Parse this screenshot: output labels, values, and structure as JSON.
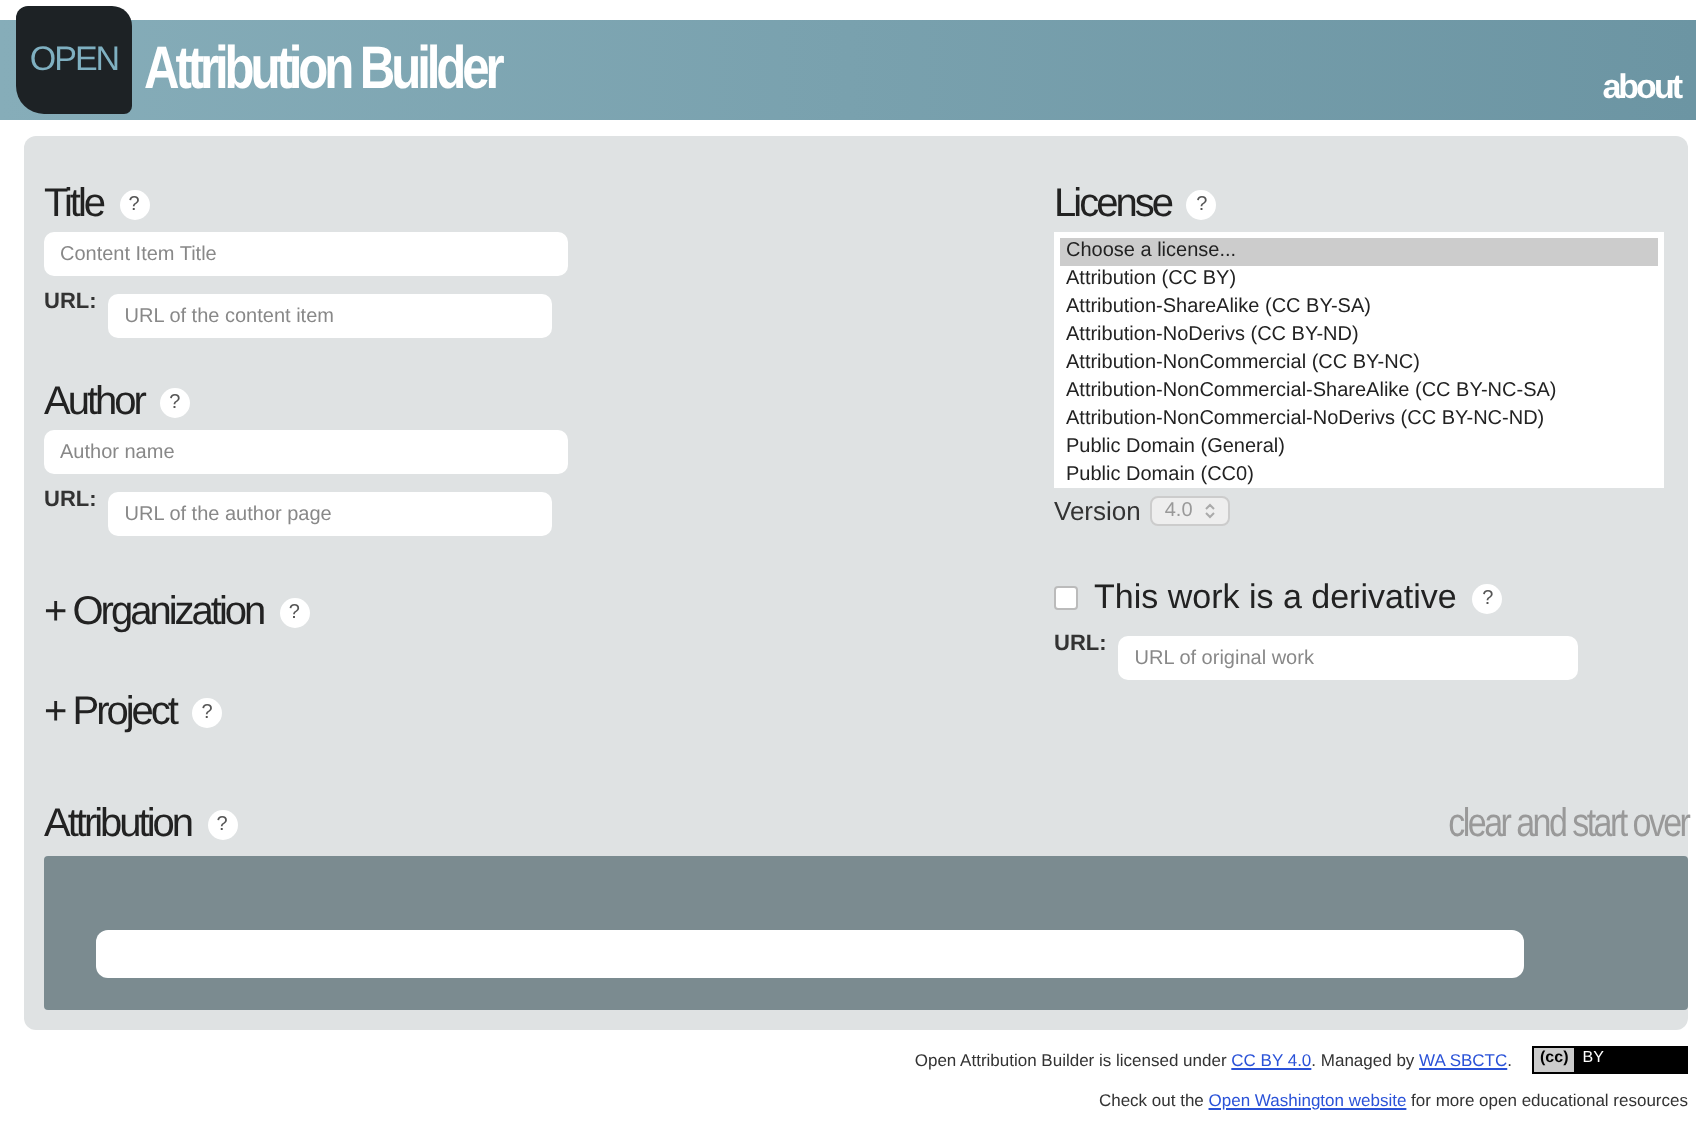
{
  "header": {
    "logo_text": "OPEN",
    "title": "Attribution Builder",
    "about": "about"
  },
  "title_section": {
    "label": "Title",
    "help": "?",
    "placeholder": "Content Item Title",
    "url_label": "URL:",
    "url_placeholder": "URL of the content item"
  },
  "author_section": {
    "label": "Author",
    "help": "?",
    "placeholder": "Author name",
    "url_label": "URL:",
    "url_placeholder": "URL of the author page"
  },
  "expanders": [
    {
      "icon": "+",
      "label": "Organization",
      "help": "?",
      "expanded": false
    },
    {
      "icon": "+",
      "label": "Project",
      "help": "?",
      "expanded": false
    }
  ],
  "license": {
    "label": "License",
    "help": "?",
    "options": [
      {
        "label": "Choose a license...",
        "selected": true
      },
      {
        "label": "Attribution (CC BY)",
        "selected": false
      },
      {
        "label": "Attribution-ShareAlike (CC BY-SA)",
        "selected": false
      },
      {
        "label": "Attribution-NoDerivs (CC BY-ND)",
        "selected": false
      },
      {
        "label": "Attribution-NonCommercial (CC BY-NC)",
        "selected": false
      },
      {
        "label": "Attribution-NonCommercial-ShareAlike (CC BY-NC-SA)",
        "selected": false
      },
      {
        "label": "Attribution-NonCommercial-NoDerivs (CC BY-NC-ND)",
        "selected": false
      },
      {
        "label": "Public Domain (General)",
        "selected": false
      },
      {
        "label": "Public Domain (CC0)",
        "selected": false
      }
    ],
    "version_label": "Version",
    "version": "4.0"
  },
  "derivative": {
    "label": "This work is a derivative",
    "help": "?",
    "checked": false,
    "url_label": "URL:",
    "url_placeholder": "URL of original work"
  },
  "attribution": {
    "label": "Attribution",
    "help": "?",
    "clear": "clear and start over"
  },
  "footer": {
    "line1_before": "Open Attribution Builder is licensed under ",
    "link1": "CC BY 4.0",
    "line1_mid": ". Managed by ",
    "link2": "WA SBCTC",
    "line1_after": ".",
    "badge_left": "(cc)",
    "badge_right": "BY",
    "line2_before": "Check out the ",
    "link3": "Open Washington website",
    "line2_after": " for more open educational resources"
  }
}
